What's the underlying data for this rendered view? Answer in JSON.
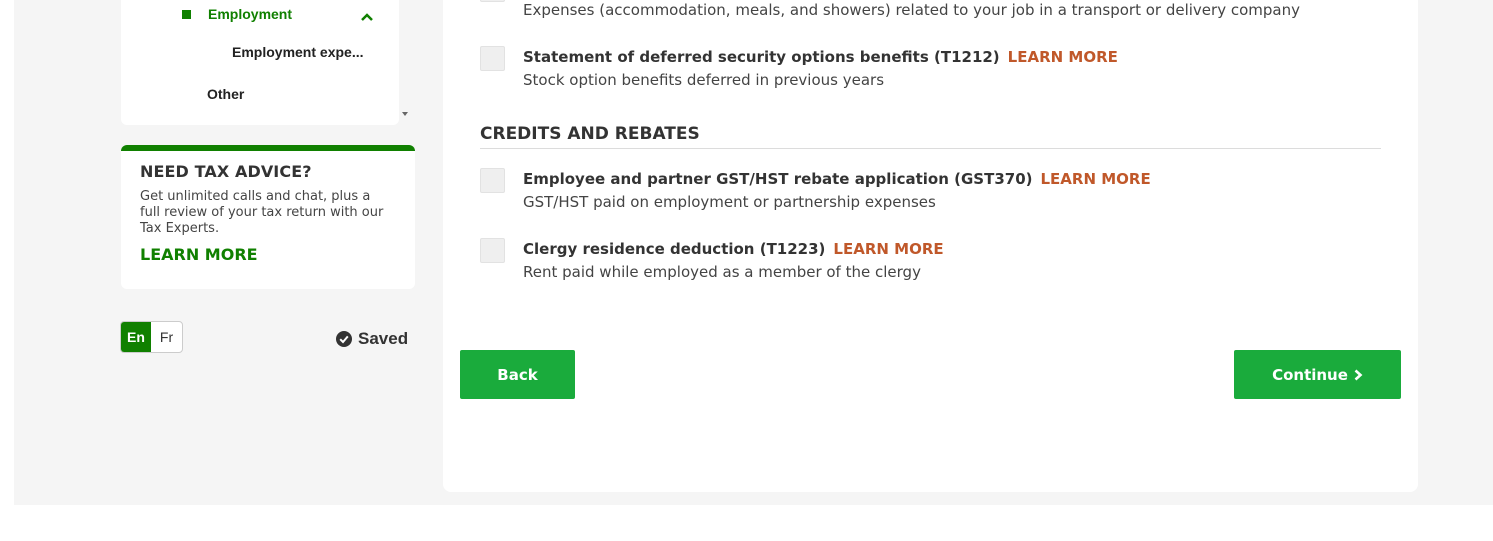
{
  "sidebar": {
    "nav": {
      "employment": "Employment",
      "employment_expenses": "Employment expe...",
      "other": "Other"
    },
    "advice": {
      "title": "NEED TAX ADVICE?",
      "text": "Get unlimited calls and chat, plus a full review of your tax return with our Tax Experts.",
      "link": "LEARN MORE"
    },
    "lang": {
      "en": "En",
      "fr": "Fr",
      "active": "En"
    },
    "saved_label": "Saved"
  },
  "main": {
    "top_partial_desc": "Expenses (accommodation, meals, and showers) related to your job in a transport or delivery company",
    "items_top": [
      {
        "title": "Statement of deferred security options benefits (T1212)",
        "learn": "LEARN MORE",
        "desc": "Stock option benefits deferred in previous years"
      }
    ],
    "credits_section": {
      "heading": "CREDITS AND REBATES",
      "items": [
        {
          "title": "Employee and partner GST/HST rebate application (GST370)",
          "learn": "LEARN MORE",
          "desc": "GST/HST paid on employment or partnership expenses"
        },
        {
          "title": "Clergy residence deduction (T1223)",
          "learn": "LEARN MORE",
          "desc": "Rent paid while employed as a member of the clergy"
        }
      ]
    },
    "buttons": {
      "back": "Back",
      "continue": "Continue"
    }
  },
  "colors": {
    "brand_green": "#108000",
    "button_green": "#1aab3c",
    "learn_more": "#c0582a"
  },
  "icons": {
    "nav_expand": "chevron-up-icon",
    "saved": "check-circle-icon",
    "continue": "chevron-right-icon"
  }
}
